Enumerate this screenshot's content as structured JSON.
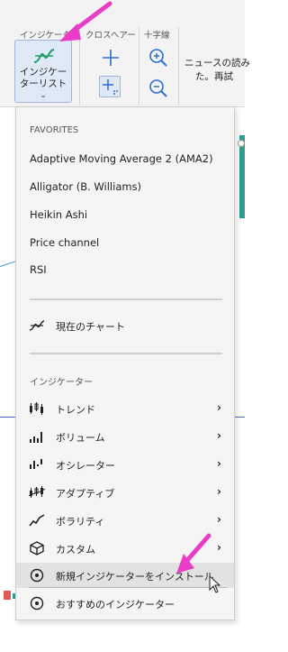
{
  "ribbon": {
    "indicator_group": "インジケーター",
    "crosshair_group": "クロスヘアー",
    "cross_group": "十字線",
    "indicator_button": {
      "line1": "インジケー",
      "line2": "ターリスト",
      "chevron": "⌄"
    },
    "news_line1": "ニュースの読み",
    "news_line2": "た。再試",
    "icons": [
      "indicator-curve-icon",
      "crosshair-icon",
      "crosshair-snap-icon",
      "zoom-in-icon",
      "zoom-out-icon"
    ]
  },
  "menu": {
    "favorites_header": "FAVORITES",
    "favorites": [
      "Adaptive Moving Average 2 (AMA2)",
      "Alligator (B. Williams)",
      "Heikin Ashi",
      "Price channel",
      "RSI"
    ],
    "current_chart": {
      "label": "現在のチャート",
      "icon": "indicator-curve-icon"
    },
    "indicators_header": "インジケーター",
    "categories": [
      {
        "label": "トレンド",
        "icon": "trend-icon",
        "chevron": "›"
      },
      {
        "label": "ボリューム",
        "icon": "volume-icon",
        "chevron": "›"
      },
      {
        "label": "オシレーター",
        "icon": "oscillator-icon",
        "chevron": "›"
      },
      {
        "label": "アダプティブ",
        "icon": "adaptive-icon",
        "chevron": "›"
      },
      {
        "label": "ボラリティ",
        "icon": "volatility-icon",
        "chevron": "›"
      },
      {
        "label": "カスタム",
        "icon": "cube-icon",
        "chevron": "›"
      }
    ],
    "install_new": {
      "label": "新規インジケーターをインストール",
      "icon": "target-icon"
    },
    "recommended": {
      "label": "おすすめのインジケーター",
      "icon": "target-icon"
    }
  },
  "colors": {
    "accent_arrow": "#e83cc9",
    "indicator_green": "#1f9e6a",
    "crosshair_blue": "#2a6fce",
    "chart_line_blue": "#3a6fd8",
    "chart_bar_teal": "#2f9e8f"
  }
}
